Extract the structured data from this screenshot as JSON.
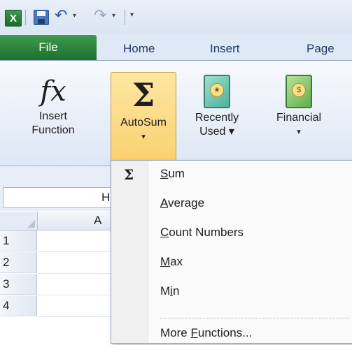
{
  "qat": {
    "app_icon": "X",
    "undo_glyph": "↶",
    "redo_glyph": "↷",
    "customize_glyph": "▾"
  },
  "tabs": {
    "file": "File",
    "home": "Home",
    "insert": "Insert",
    "page": "Page"
  },
  "ribbon": {
    "insert_function_icon": "fx",
    "insert_function_line1": "Insert",
    "insert_function_line2": "Function",
    "autosum_icon": "Σ",
    "autosum_label": "AutoSum",
    "autosum_arrow": "▾",
    "recently_used_line1": "Recently",
    "recently_used_line2": "Used ▾",
    "financial_line1": "Financial",
    "financial_line2": "▾"
  },
  "namebox": {
    "value": "H"
  },
  "grid": {
    "columns": [
      "A"
    ],
    "rows": [
      "1",
      "2",
      "3",
      "4"
    ]
  },
  "menu": {
    "icon": "Σ",
    "items": [
      {
        "mnemonic": "S",
        "rest": "um"
      },
      {
        "mnemonic": "A",
        "rest": "verage"
      },
      {
        "mnemonic": "C",
        "rest": "ount Numbers"
      },
      {
        "mnemonic": "M",
        "rest": "ax"
      },
      {
        "pre": "M",
        "mnemonic": "i",
        "rest": "n"
      }
    ],
    "more": {
      "pre": "More ",
      "mnemonic": "F",
      "rest": "unctions..."
    }
  }
}
